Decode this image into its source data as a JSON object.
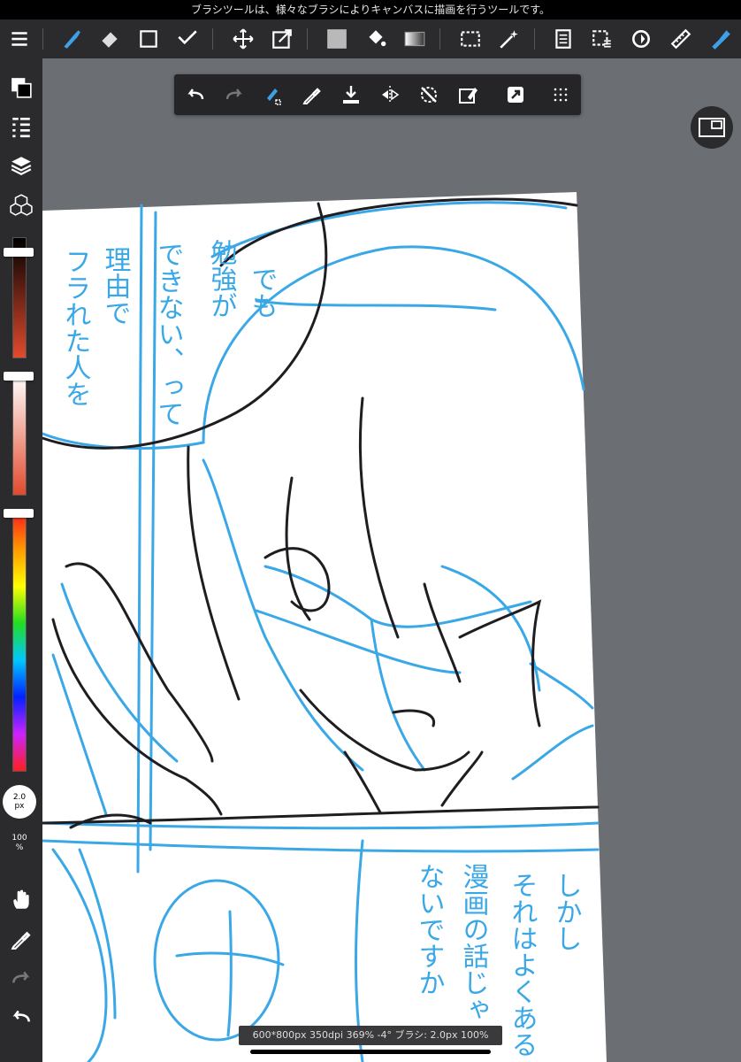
{
  "hint": "ブラシツールは、様々なブラシによりキャンバスに描画を行うツールです。",
  "toolbar": {
    "tools": [
      "menu-icon",
      "brush-icon",
      "eraser-icon",
      "shape-icon",
      "line-icon",
      "move-icon",
      "transform-icon",
      "fill-color-icon",
      "bucket-icon",
      "gradient-icon",
      "select-icon",
      "magic-wand-icon",
      "page-icon",
      "select-list-icon",
      "rotate-icon",
      "ruler-icon",
      "blue-brush-icon"
    ],
    "accent": "#3ea1e8"
  },
  "float_toolbar": [
    "undo",
    "redo",
    "brush-stabilizer",
    "eyedropper",
    "save-download",
    "flip",
    "snap-off",
    "clear",
    "actions",
    "grid"
  ],
  "sidebar": {
    "brush_size": "2.0",
    "brush_unit": "px",
    "opacity": "100",
    "opacity_unit": "%"
  },
  "status": "600*800px 350dpi 369% -4° ブラシ: 2.0px 100%",
  "sketch_text": {
    "t1": "でも",
    "t2": "勉強が",
    "t3": "できない、って",
    "t4": "理由で",
    "t5": "フラれた人を",
    "t6": "しかし",
    "t7": "それはよくある",
    "t8": "漫画の話じゃ",
    "t9": "ないですか"
  }
}
